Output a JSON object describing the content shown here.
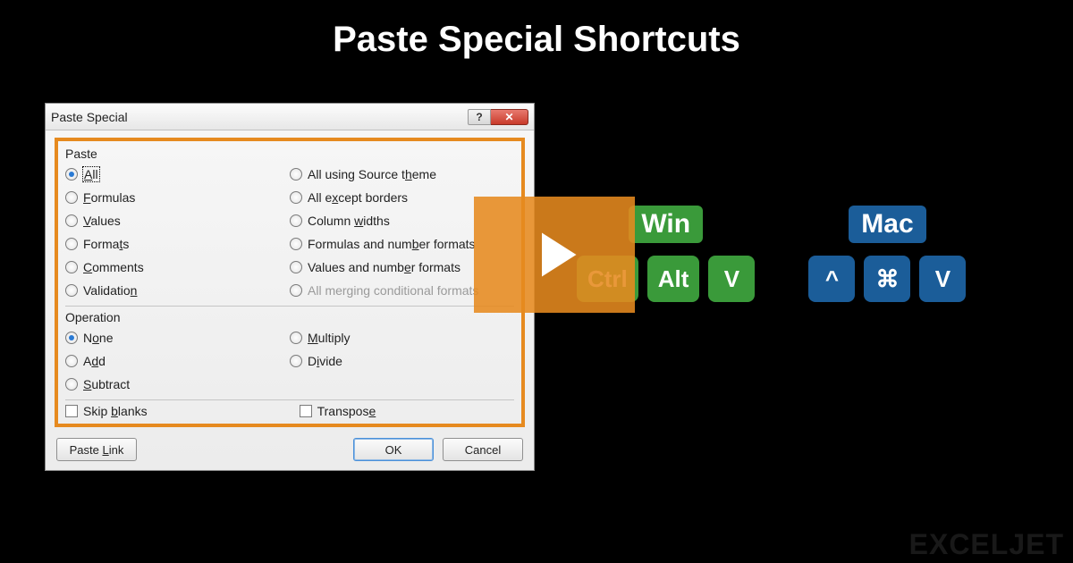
{
  "title": "Paste Special Shortcuts",
  "dialog": {
    "window_title": "Paste Special",
    "help_label": "?",
    "close_label": "✕",
    "paste_group_label": "Paste",
    "paste_left": [
      {
        "pre": "",
        "u": "A",
        "post": "ll",
        "selected": true,
        "focused": true
      },
      {
        "pre": "",
        "u": "F",
        "post": "ormulas",
        "selected": false
      },
      {
        "pre": "",
        "u": "V",
        "post": "alues",
        "selected": false
      },
      {
        "pre": "Forma",
        "u": "t",
        "post": "s",
        "selected": false
      },
      {
        "pre": "",
        "u": "C",
        "post": "omments",
        "selected": false
      },
      {
        "pre": "Validatio",
        "u": "n",
        "post": "",
        "selected": false
      }
    ],
    "paste_right": [
      {
        "pre": "All using Source t",
        "u": "h",
        "post": "eme",
        "selected": false
      },
      {
        "pre": "All e",
        "u": "x",
        "post": "cept borders",
        "selected": false
      },
      {
        "pre": "Column ",
        "u": "w",
        "post": "idths",
        "selected": false
      },
      {
        "pre": "Formulas and num",
        "u": "b",
        "post": "er formats",
        "selected": false
      },
      {
        "pre": "Values and numb",
        "u": "e",
        "post": "r formats",
        "selected": false
      },
      {
        "pre": "All merging conditional formats",
        "u": "",
        "post": "",
        "selected": false,
        "disabled": true
      }
    ],
    "operation_group_label": "Operation",
    "op_left": [
      {
        "pre": "N",
        "u": "o",
        "post": "ne",
        "selected": true
      },
      {
        "pre": "A",
        "u": "d",
        "post": "d",
        "selected": false
      },
      {
        "pre": "",
        "u": "S",
        "post": "ubtract",
        "selected": false
      }
    ],
    "op_right": [
      {
        "pre": "",
        "u": "M",
        "post": "ultiply",
        "selected": false
      },
      {
        "pre": "D",
        "u": "i",
        "post": "vide",
        "selected": false
      }
    ],
    "skip_blanks_pre": "Skip ",
    "skip_blanks_u": "b",
    "skip_blanks_post": "lanks",
    "transpose_pre": "Transpos",
    "transpose_u": "e",
    "transpose_post": "",
    "paste_link_pre": "Paste ",
    "paste_link_u": "L",
    "paste_link_post": "ink",
    "ok_label": "OK",
    "cancel_label": "Cancel"
  },
  "shortcuts": {
    "win_label": "Win",
    "mac_label": "Mac",
    "win_keys": [
      "Ctrl",
      "Alt",
      "V"
    ],
    "mac_keys": [
      "^",
      "⌘",
      "V"
    ]
  },
  "watermark": "EXCELJET"
}
